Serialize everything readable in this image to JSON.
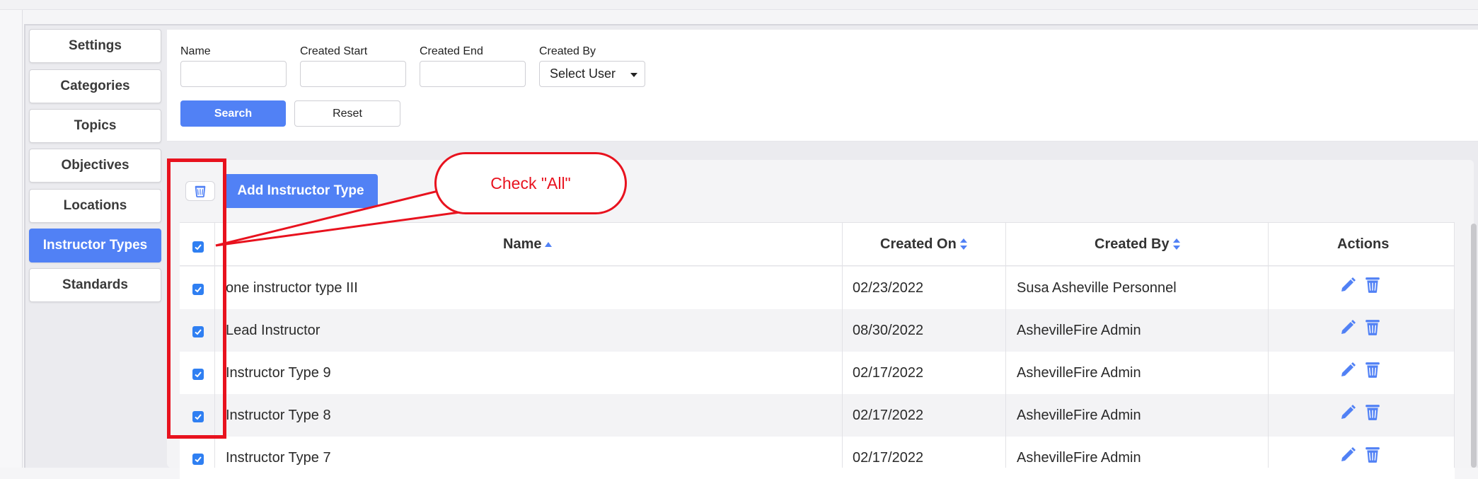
{
  "sidebar": {
    "items": [
      {
        "label": "Settings"
      },
      {
        "label": "Categories"
      },
      {
        "label": "Topics"
      },
      {
        "label": "Objectives"
      },
      {
        "label": "Locations"
      },
      {
        "label": "Instructor Types",
        "active": true
      },
      {
        "label": "Standards"
      }
    ]
  },
  "filters": {
    "name_label": "Name",
    "name_value": "",
    "created_start_label": "Created Start",
    "created_start_value": "",
    "created_end_label": "Created End",
    "created_end_value": "",
    "created_by_label": "Created By",
    "created_by_value": "Select User",
    "search_label": "Search",
    "reset_label": "Reset"
  },
  "toolbar": {
    "add_label": "Add Instructor Type"
  },
  "table": {
    "columns": [
      "Name",
      "Created On",
      "Created By",
      "Actions"
    ],
    "select_all_checked": true,
    "rows": [
      {
        "name": "one instructor type III",
        "created_on": "02/23/2022",
        "created_by": "Susa Asheville Personnel",
        "checked": true
      },
      {
        "name": "Lead Instructor",
        "created_on": "08/30/2022",
        "created_by": "AshevilleFire Admin",
        "checked": true
      },
      {
        "name": "Instructor Type 9",
        "created_on": "02/17/2022",
        "created_by": "AshevilleFire Admin",
        "checked": true
      },
      {
        "name": "Instructor Type 8",
        "created_on": "02/17/2022",
        "created_by": "AshevilleFire Admin",
        "checked": true
      },
      {
        "name": "Instructor Type 7",
        "created_on": "02/17/2022",
        "created_by": "AshevilleFire Admin",
        "checked": true
      }
    ]
  },
  "annotation": {
    "callout_text": "Check \"All\"",
    "color": "#e8121e"
  },
  "colors": {
    "accent": "#5181f5",
    "checkbox": "#2f7ff2"
  },
  "icons": [
    "trash-icon",
    "pencil-icon",
    "sort-asc-icon",
    "sort-both-icon",
    "chevron-down-icon",
    "checkmark-icon"
  ]
}
